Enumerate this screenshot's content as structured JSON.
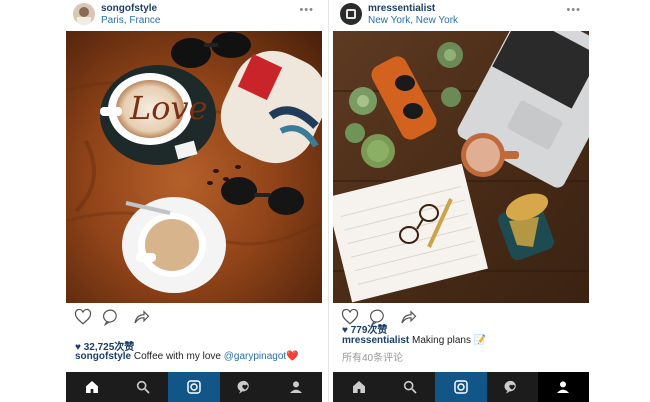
{
  "posts": [
    {
      "username": "songofstyle",
      "location": "Paris, France",
      "more": "•••",
      "likes": "♥ 32,725次赞",
      "caption_user": "songofstyle",
      "caption_text": " Coffee with my love ",
      "caption_mention": "@garypinagot",
      "caption_emoji": "❤️",
      "latte_art_text": "Love"
    },
    {
      "username": "mressentialist",
      "location": "New York, New York",
      "more": "•••",
      "likes": "♥ 779次赞",
      "caption_user": "mressentialist",
      "caption_text": " Making plans 📝",
      "comments": "所有40条评论"
    }
  ],
  "nav_icons": [
    "home-icon",
    "search-icon",
    "camera-icon",
    "activity-icon",
    "profile-icon"
  ],
  "colors": {
    "nav_bg": "#1c1c1c",
    "nav_active": "#125688",
    "username": "#1d3f66",
    "link": "#2a6fa8"
  }
}
